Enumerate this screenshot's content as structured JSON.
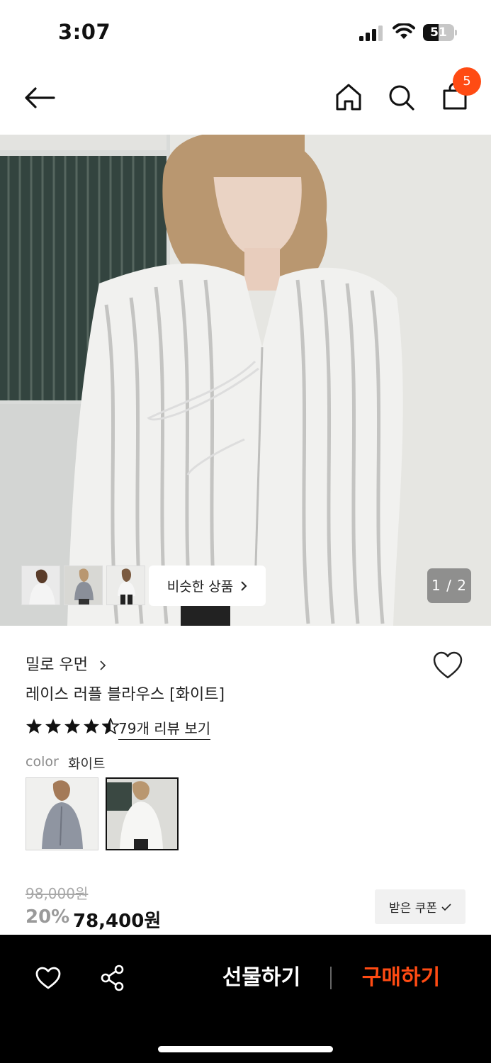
{
  "status_bar": {
    "time": "3:07",
    "battery": "51",
    "battery_level": 0.51,
    "icons": [
      "signal-icon",
      "wifi-icon",
      "battery-icon"
    ]
  },
  "nav": {
    "icons": [
      "back-arrow-icon",
      "home-icon",
      "search-icon",
      "shopping-bag-icon"
    ],
    "cart_count": "5"
  },
  "gallery": {
    "similar_label": "비슷한 상품",
    "page_indicator": "1 / 2",
    "thumbnails": 3
  },
  "product": {
    "brand": "밀로 우먼",
    "name": "레이스 러플 블라우스 [화이트]",
    "rating_stars": 4.5,
    "review_link": "79개 리뷰 보기",
    "color_label": "color",
    "color_value": "화이트",
    "options": [
      "gray-option",
      "white-option"
    ],
    "price_original": "98,000원",
    "discount": "20%",
    "price_final": "78,400원",
    "coupon_label": "받은 쿠폰"
  },
  "bottom_bar": {
    "gift_label": "선물하기",
    "buy_label": "구매하기",
    "icons": [
      "heart-icon",
      "share-icon"
    ]
  },
  "colors": {
    "accent": "#ff4b13",
    "bottom_bar": "#000000"
  }
}
